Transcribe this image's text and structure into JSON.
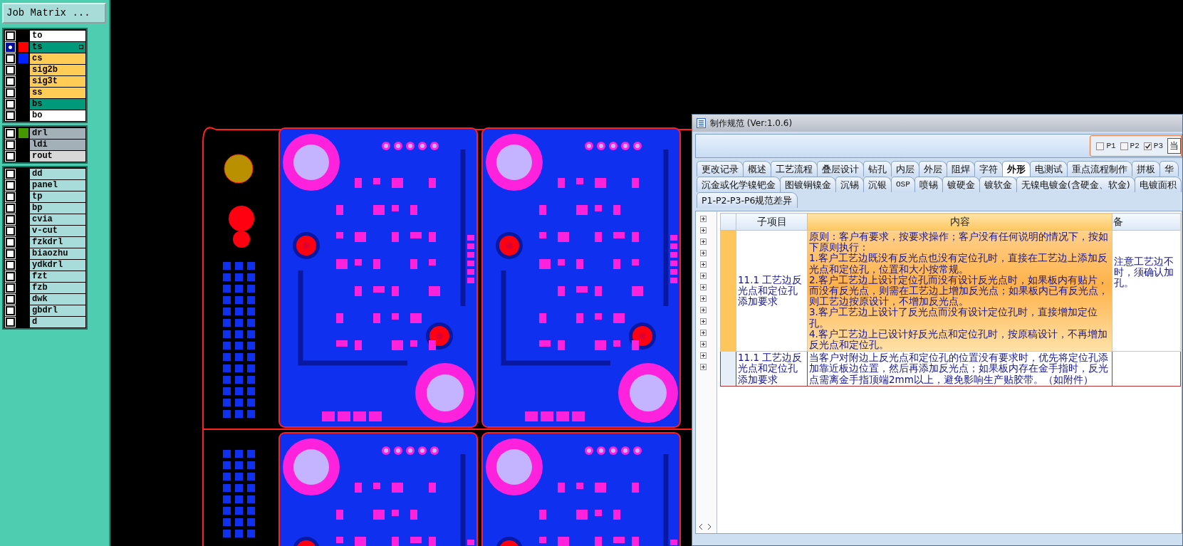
{
  "left_panel": {
    "job_matrix_button": "Job Matrix ...",
    "layer_groups": [
      {
        "layers": [
          {
            "name": "to",
            "color": "#ffffff",
            "selected": false
          },
          {
            "name": "ts",
            "color": "#00997a",
            "swatch": {
              "color": "#ff0000"
            },
            "selected": true
          },
          {
            "name": "cs",
            "color": "#ffcc55",
            "swatch": {
              "color": "#0022ff"
            },
            "selected": false
          },
          {
            "name": "sig2b",
            "color": "#ffcc55",
            "selected": false
          },
          {
            "name": "sig3t",
            "color": "#ffcc55",
            "selected": false
          },
          {
            "name": "ss",
            "color": "#ffcc55",
            "selected": false
          },
          {
            "name": "bs",
            "color": "#00997a",
            "selected": false
          },
          {
            "name": "bo",
            "color": "#ffffff",
            "selected": false
          }
        ]
      },
      {
        "layers": [
          {
            "name": "drl",
            "color": "#a3b0b8",
            "swatch": {
              "color": "#449900"
            },
            "selected": false
          },
          {
            "name": "ldi",
            "color": "#a3b0b8",
            "selected": false
          },
          {
            "name": "rout",
            "color": "#d8d8d8",
            "selected": false
          }
        ]
      },
      {
        "layers": [
          {
            "name": "dd",
            "color": "#a8dcda",
            "selected": false
          },
          {
            "name": "panel",
            "color": "#a8dcda",
            "selected": false
          },
          {
            "name": "tp",
            "color": "#a8dcda",
            "selected": false
          },
          {
            "name": "bp",
            "color": "#a8dcda",
            "selected": false
          },
          {
            "name": "cvia",
            "color": "#a8dcda",
            "selected": false
          },
          {
            "name": "v-cut",
            "color": "#a8dcda",
            "selected": false
          },
          {
            "name": "fzkdrl",
            "color": "#a8dcda",
            "selected": false
          },
          {
            "name": "biaozhu",
            "color": "#a8dcda",
            "selected": false
          },
          {
            "name": "ydkdrl",
            "color": "#a8dcda",
            "selected": false
          },
          {
            "name": "fzt",
            "color": "#a8dcda",
            "selected": false
          },
          {
            "name": "fzb",
            "color": "#a8dcda",
            "selected": false
          },
          {
            "name": "dwk",
            "color": "#a8dcda",
            "selected": false
          },
          {
            "name": "gbdrl",
            "color": "#a8dcda",
            "selected": false
          },
          {
            "name": "d",
            "color": "#a8dcda",
            "selected": false
          }
        ]
      }
    ]
  },
  "window": {
    "title": "制作规范 (Ver:1.0.6)",
    "page_filters": [
      {
        "label": "P1",
        "checked": false
      },
      {
        "label": "P2",
        "checked": false
      },
      {
        "label": "P3",
        "checked": true
      }
    ],
    "current_button": "当",
    "tab_rows": [
      [
        {
          "label": "更改记录",
          "selected": false
        },
        {
          "label": "概述",
          "selected": false
        },
        {
          "label": "工艺流程",
          "selected": false
        },
        {
          "label": "叠层设计",
          "selected": false
        },
        {
          "label": "钻孔",
          "selected": false
        },
        {
          "label": "内层",
          "selected": false
        },
        {
          "label": "外层",
          "selected": false
        },
        {
          "label": "阻焊",
          "selected": false
        },
        {
          "label": "字符",
          "selected": false
        },
        {
          "label": "外形",
          "selected": true
        },
        {
          "label": "电测试",
          "selected": false
        },
        {
          "label": "重点流程制作",
          "selected": false
        },
        {
          "label": "拼板",
          "selected": false
        },
        {
          "label": "华",
          "selected": false
        }
      ],
      [
        {
          "label": "沉金或化学镍钯金",
          "selected": false
        },
        {
          "label": "图镀铜镍金",
          "selected": false
        },
        {
          "label": "沉锡",
          "selected": false
        },
        {
          "label": "沉银",
          "selected": false
        },
        {
          "label": "OSP",
          "selected": false
        },
        {
          "label": "喷锡",
          "selected": false
        },
        {
          "label": "镀硬金",
          "selected": false
        },
        {
          "label": "镀软金",
          "selected": false
        },
        {
          "label": "无镍电镀金(含硬金、软金)",
          "selected": false
        },
        {
          "label": "电镀面积",
          "selected": false
        }
      ],
      [
        {
          "label": "P1-P2-P3-P6规范差异",
          "selected": false
        }
      ]
    ],
    "table": {
      "columns": [
        "子项目",
        "内容",
        "备"
      ],
      "rows": [
        {
          "selected": true,
          "item": "11.1 工艺边反光点和定位孔添加要求",
          "content": [
            "原则：客户有要求，按要求操作；客户没有任何说明的情况下，按如下原则执行：",
            "1.客户工艺边既没有反光点也没有定位孔时，直接在工艺边上添加反光点和定位孔，位置和大小按常规。",
            "2.客户工艺边上设计定位孔而没有设计反光点时，如果板内有贴片，而没有反光点，则需在工艺边上增加反光点；如果板内已有反光点，则工艺边按原设计，不增加反光点。",
            "3.客户工艺边上设计了反光点而没有设计定位孔时，直接增加定位孔。",
            "4.客户工艺边上已设计好反光点和定位孔时，按原稿设计，不再增加反光点和定位孔。"
          ],
          "remark": "注意工艺边不时，须确认加孔。"
        },
        {
          "selected": false,
          "item": "11.1 工艺边反光点和定位孔添加要求",
          "content": [
            "当客户对附边上反光点和定位孔的位置没有要求时，优先将定位孔添加靠近板边位置，然后再添加反光点；如果板内存在金手指时，反光点需离金手指顶端2mm以上，避免影响生产贴胶带。（如附件）"
          ]
        }
      ]
    }
  }
}
